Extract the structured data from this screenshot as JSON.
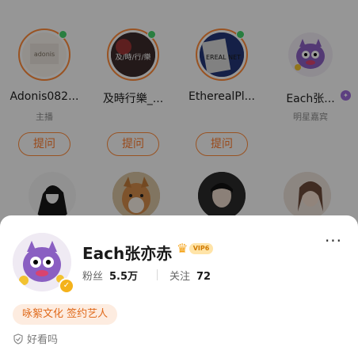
{
  "users": [
    {
      "name": "Adonis082...",
      "role": "主播",
      "ask_label": "提问",
      "online": true,
      "avatar_text": "adonis"
    },
    {
      "name": "及時行樂_...",
      "role": "",
      "ask_label": "提问",
      "online": true,
      "avatar_text": "及/時/行/樂"
    },
    {
      "name": "EtherealPl...",
      "role": "",
      "ask_label": "提问",
      "online": true,
      "avatar_text": "EREAL NET"
    },
    {
      "name": "Each张...",
      "role": "明星嘉宾",
      "ask_label": "",
      "online": false,
      "avatar_text": ""
    }
  ],
  "profile": {
    "name": "Each张亦赤",
    "vip_label": "VIP6",
    "fans_label": "粉丝",
    "fans_count": "5.5万",
    "following_label": "关注",
    "following_count": "72",
    "tag": "咏絮文化 签约艺人",
    "reputation": "好看吗",
    "more_label": "···"
  },
  "colors": {
    "accent": "#ff7a2a",
    "online": "#45d26b",
    "verified_purple": "#9b6bd8",
    "verified_gold": "#f4b21b"
  }
}
